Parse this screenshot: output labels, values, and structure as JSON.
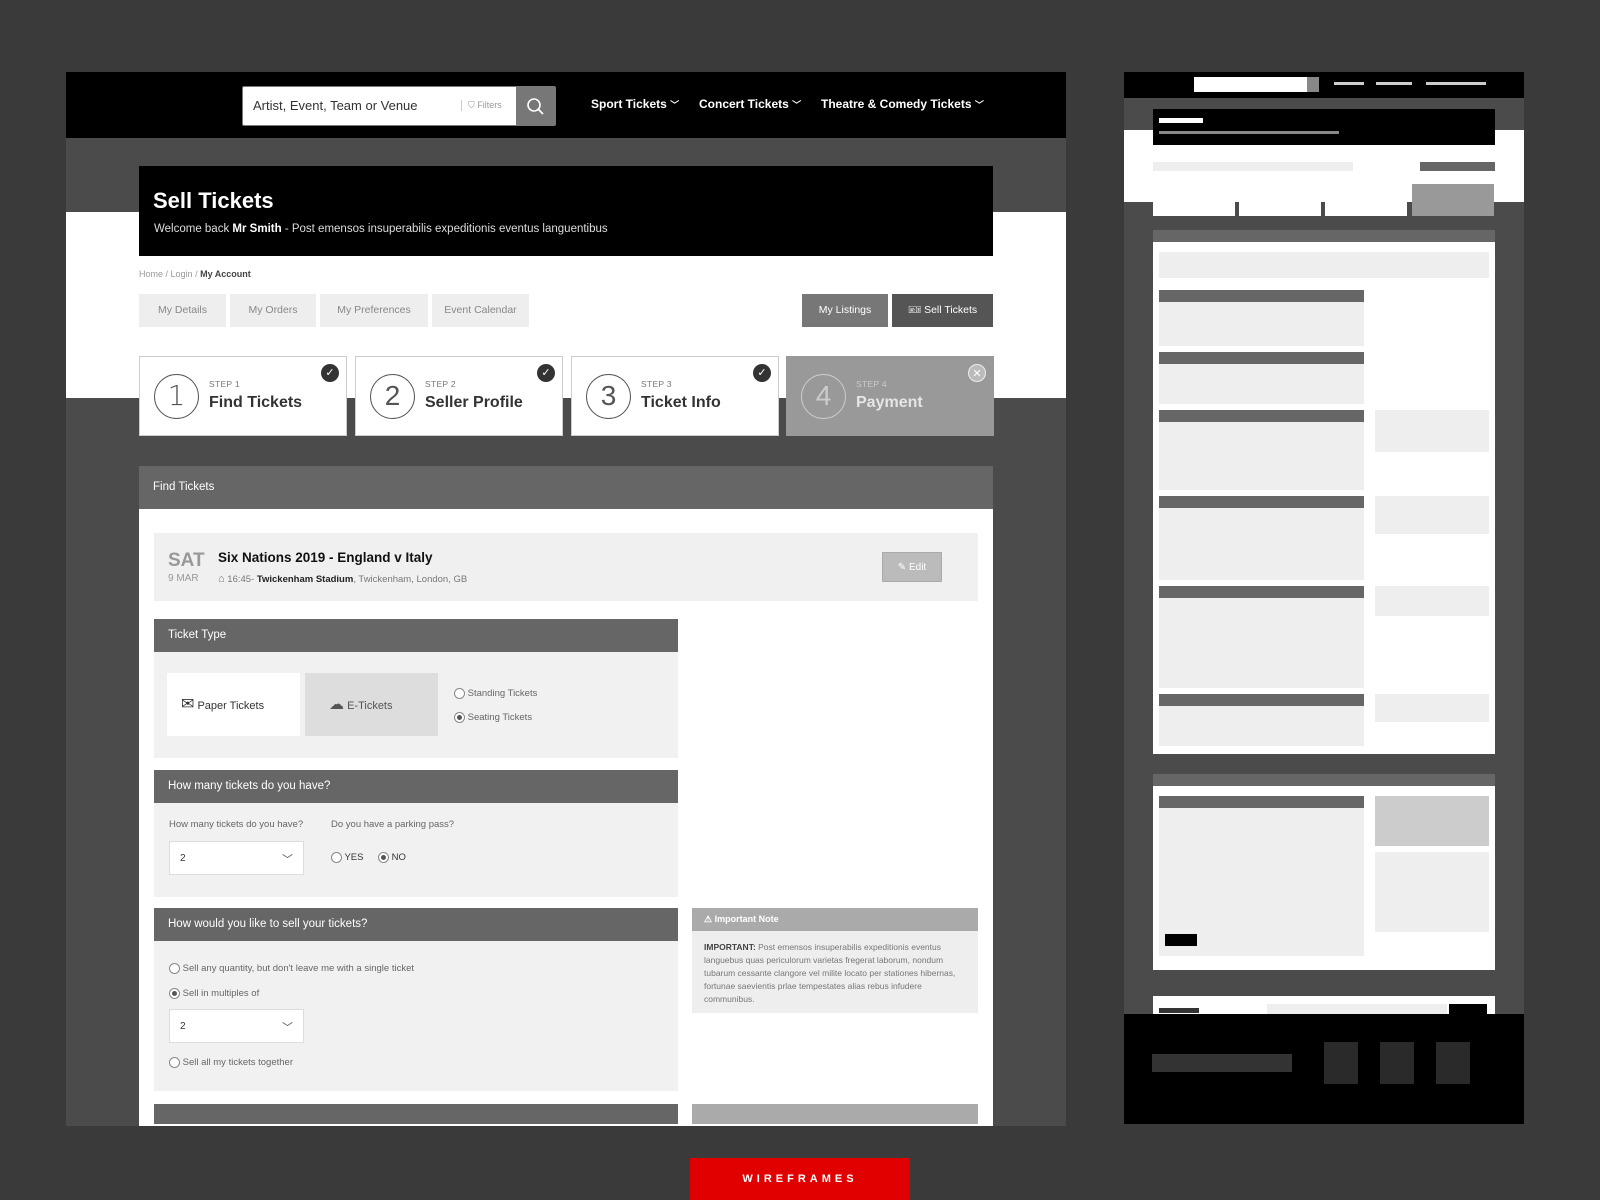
{
  "header": {
    "search_placeholder": "Artist, Event, Team or Venue",
    "filters_label": "Filters",
    "nav": [
      {
        "label": "Sport Tickets"
      },
      {
        "label": "Concert Tickets"
      },
      {
        "label": "Theatre & Comedy Tickets"
      }
    ]
  },
  "hero": {
    "title": "Sell Tickets",
    "welcome_prefix": "Welcome back",
    "user_name": "Mr Smith",
    "welcome_suffix": " - Post emensos insuperabilis expeditionis eventus languentibus"
  },
  "breadcrumb": {
    "home": "Home",
    "sep1": " / ",
    "login": "Login",
    "sep2": " / ",
    "current": "My Account"
  },
  "tabs": {
    "left": [
      "My Details",
      "My Orders",
      "My Preferences",
      "Event Calendar"
    ],
    "my_listings": "My Listings",
    "sell_tickets": "Sell Tickets"
  },
  "steps": [
    {
      "num": "1",
      "label": "STEP 1",
      "name": "Find Tickets",
      "status": "complete"
    },
    {
      "num": "2",
      "label": "STEP 2",
      "name": "Seller Profile",
      "status": "complete"
    },
    {
      "num": "3",
      "label": "STEP 3",
      "name": "Ticket Info",
      "status": "complete"
    },
    {
      "num": "4",
      "label": "STEP 4",
      "name": "Payment",
      "status": "inactive"
    }
  ],
  "find_tickets": {
    "header": "Find Tickets",
    "event": {
      "day": "SAT",
      "date": "9 MAR",
      "title": "Six Nations 2019 - England v Italy",
      "time": "16:45-",
      "venue": "Twickenham Stadium",
      "location": ", Twickenham, London, GB",
      "edit_label": "Edit"
    },
    "ticket_type": {
      "header": "Ticket Type",
      "paper_label": "Paper Tickets",
      "etickets_label": "E-Tickets",
      "standing_label": "Standing Tickets",
      "seating_label": "Seating Tickets",
      "selected": "Seating Tickets"
    },
    "how_many": {
      "header": "How many tickets do you have?",
      "qty_label": "How many tickets do you have?",
      "qty_value": "2",
      "parking_label": "Do you have a parking pass?",
      "yes_label": "YES",
      "no_label": "NO",
      "parking_selected": "NO"
    },
    "how_sell": {
      "header": "How would you like to sell your tickets?",
      "option_any": "Sell any quantity, but don't leave me with a single ticket",
      "option_multiples": "Sell in multiples of",
      "multiples_value": "2",
      "option_all": "Sell all my tickets together",
      "selected": "Sell in multiples of"
    },
    "note": {
      "header": "Important Note",
      "strong": "IMPORTANT:",
      "body": " Post emensos insuperabilis expeditionis eventus languebus quas periculorum varietas fregerat laborum, nondum tubarum cessante clangore vel milite locato per stationes hibernas, fortunae saevientis prlae tempestates alias rebus infudere communibus."
    }
  },
  "badge": "WIREFRAMES",
  "colors": {
    "accent": "#e00000",
    "header_bg": "#000000",
    "section_head": "#666666",
    "page_bg": "#3a3a3a"
  }
}
